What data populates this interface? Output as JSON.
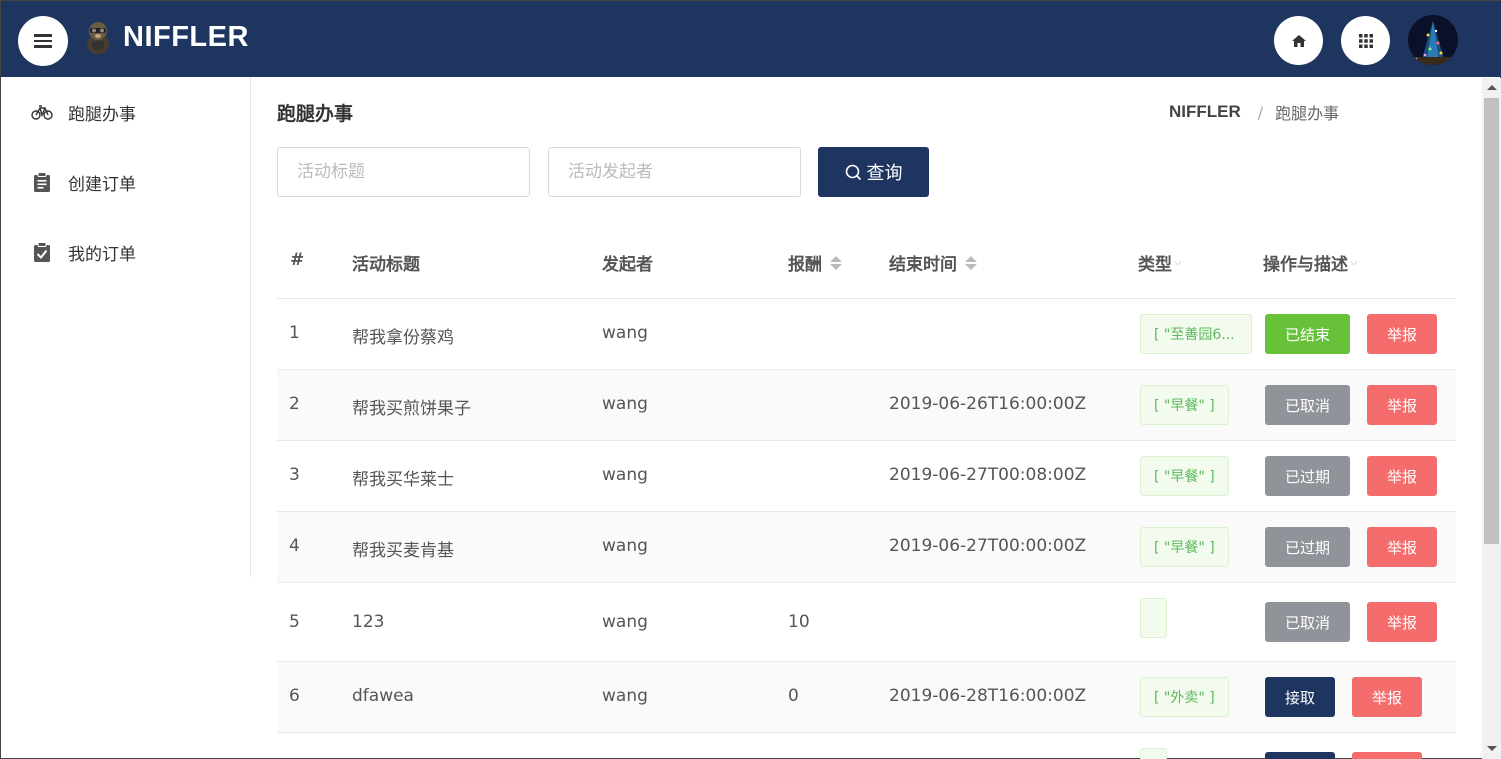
{
  "header": {
    "brand": "NIFFLER",
    "icons": {
      "menu": "menu-icon",
      "home": "home-icon",
      "apps": "grid-icon"
    },
    "colors": {
      "bar": "#1e3560"
    }
  },
  "sidebar": {
    "items": [
      {
        "label": "跑腿办事",
        "icon": "bicycle-icon"
      },
      {
        "label": "创建订单",
        "icon": "clipboard-icon"
      },
      {
        "label": "我的订单",
        "icon": "clipboard-check-icon"
      }
    ]
  },
  "page": {
    "title": "跑腿办事",
    "breadcrumb": [
      "NIFFLER",
      "/",
      "跑腿办事"
    ]
  },
  "search": {
    "title_placeholder": "活动标题",
    "initiator_placeholder": "活动发起者",
    "button": "查询"
  },
  "table": {
    "columns": [
      "#",
      "活动标题",
      "发起者",
      "报酬",
      "结束时间",
      "类型",
      "操作与描述"
    ],
    "rows": [
      {
        "id": "1",
        "title": "帮我拿份蔡鸡",
        "initiator": "wang",
        "reward": "",
        "end_time": "",
        "type": "[ \"至善园6...",
        "status": "已结束",
        "status_color": "#67c23a",
        "report": "举报"
      },
      {
        "id": "2",
        "title": "帮我买煎饼果子",
        "initiator": "wang",
        "reward": "",
        "end_time": "2019-06-26T16:00:00Z",
        "type": "[ \"早餐\" ]",
        "status": "已取消",
        "status_color": "#909399",
        "report": "举报"
      },
      {
        "id": "3",
        "title": "帮我买华莱士",
        "initiator": "wang",
        "reward": "",
        "end_time": "2019-06-27T00:08:00Z",
        "type": "[ \"早餐\" ]",
        "status": "已过期",
        "status_color": "#909399",
        "report": "举报"
      },
      {
        "id": "4",
        "title": "帮我买麦肯基",
        "initiator": "wang",
        "reward": "",
        "end_time": "2019-06-27T00:00:00Z",
        "type": "[ \"早餐\" ]",
        "status": "已过期",
        "status_color": "#909399",
        "report": "举报"
      },
      {
        "id": "5",
        "title": "123",
        "initiator": "wang",
        "reward": "10",
        "end_time": "",
        "type": "",
        "status": "已取消",
        "status_color": "#909399",
        "report": "举报"
      },
      {
        "id": "6",
        "title": "dfawea",
        "initiator": "wang",
        "reward": "0",
        "end_time": "2019-06-28T16:00:00Z",
        "type": "[ \"外卖\" ]",
        "status": "接取",
        "status_color": "#1e3560",
        "report": "举报"
      }
    ]
  }
}
